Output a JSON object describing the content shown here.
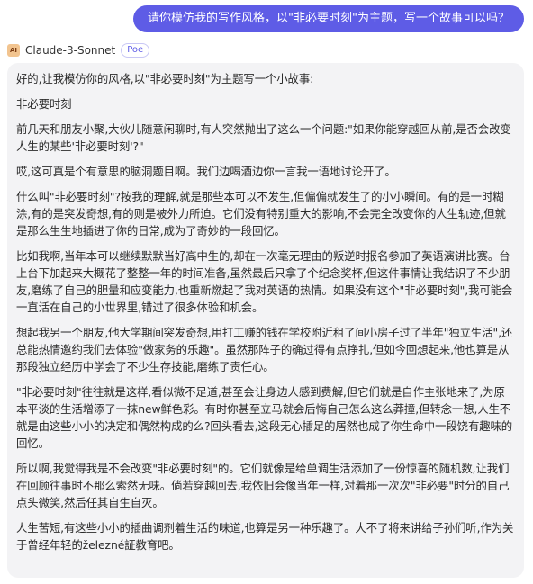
{
  "user_message": {
    "text": "请你模仿我的写作风格，以\"非必要时刻\"为主题，写一个故事可以吗？"
  },
  "bot": {
    "avatar_text": "AI",
    "name": "Claude-3-Sonnet",
    "badge": "Poe"
  },
  "reply": {
    "paragraphs": [
      "好的,让我模仿你的风格,以\"非必要时刻\"为主题写一个小故事:",
      "非必要时刻",
      "前几天和朋友小聚,大伙儿随意闲聊时,有人突然抛出了这么一个问题:\"如果你能穿越回从前,是否会改变人生的某些'非必要时刻'?\"",
      "哎,这可真是个有意思的脑洞题目啊。我们边喝酒边你一言我一语地讨论开了。",
      "什么叫\"非必要时刻\"?按我的理解,就是那些本可以不发生,但偏偏就发生了的小小瞬间。有的是一时糊涂,有的是突发奇想,有的则是被外力所迫。它们没有特别重大的影响,不会完全改变你的人生轨迹,但就是那么生生地插进了你的日常,成为了奇妙的一段回忆。",
      "比如我啊,当年本可以继续默默当好高中生的,却在一次毫无理由的叛逆时报名参加了英语演讲比赛。台上台下加起来大概花了整整一年的时间准备,虽然最后只拿了个纪念奖杯,但这件事情让我结识了不少朋友,磨练了自己的胆量和应变能力,也重新燃起了我对英语的热情。如果没有这个\"非必要时刻\",我可能会一直活在自己的小世界里,错过了很多体验和机会。",
      "想起我另一个朋友,他大学期间突发奇想,用打工赚的钱在学校附近租了间小房子过了半年\"独立生活\",还总能热情邀约我们去体验\"做家务的乐趣\"。虽然那阵子的确过得有点挣扎,但如今回想起来,他也算是从那段独立经历中学会了不少生存技能,磨练了责任心。",
      "\"非必要时刻\"往往就是这样,看似微不足道,甚至会让身边人感到费解,但它们就是自作主张地来了,为原本平淡的生活增添了一抹new鲜色彩。有时你甚至立马就会后悔自己怎么这么莽撞,但转念一想,人生不就是由这些小小的决定和偶然构成的么?回头看去,这段无心插足的居然也成了你生命中一段饶有趣味的回忆。",
      "所以啊,我觉得我是不会改变\"非必要时刻\"的。它们就像是给单调生活添加了一份惊喜的随机数,让我们在回顾往事时不那么索然无味。倘若穿越回去,我依旧会像当年一样,对着那一次次\"非必要\"时分的自己点头微笑,然后任其自生自灭。",
      "人生苦短,有这些小小的插曲调剂着生活的味道,也算是另一种乐趣了。大不了将来讲给子孙们听,作为关于曾经年轻的železné証教育吧。"
    ]
  }
}
